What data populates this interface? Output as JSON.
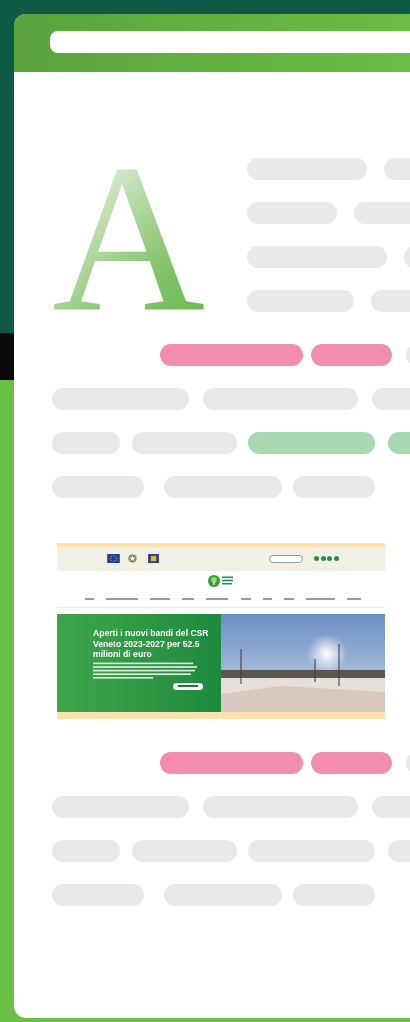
{
  "drop_cap": "A",
  "site": {
    "hero": {
      "title": "Aperti i nuovi bandi del CSR Veneto 2023-2027 per 52.5 milioni di euro"
    }
  }
}
